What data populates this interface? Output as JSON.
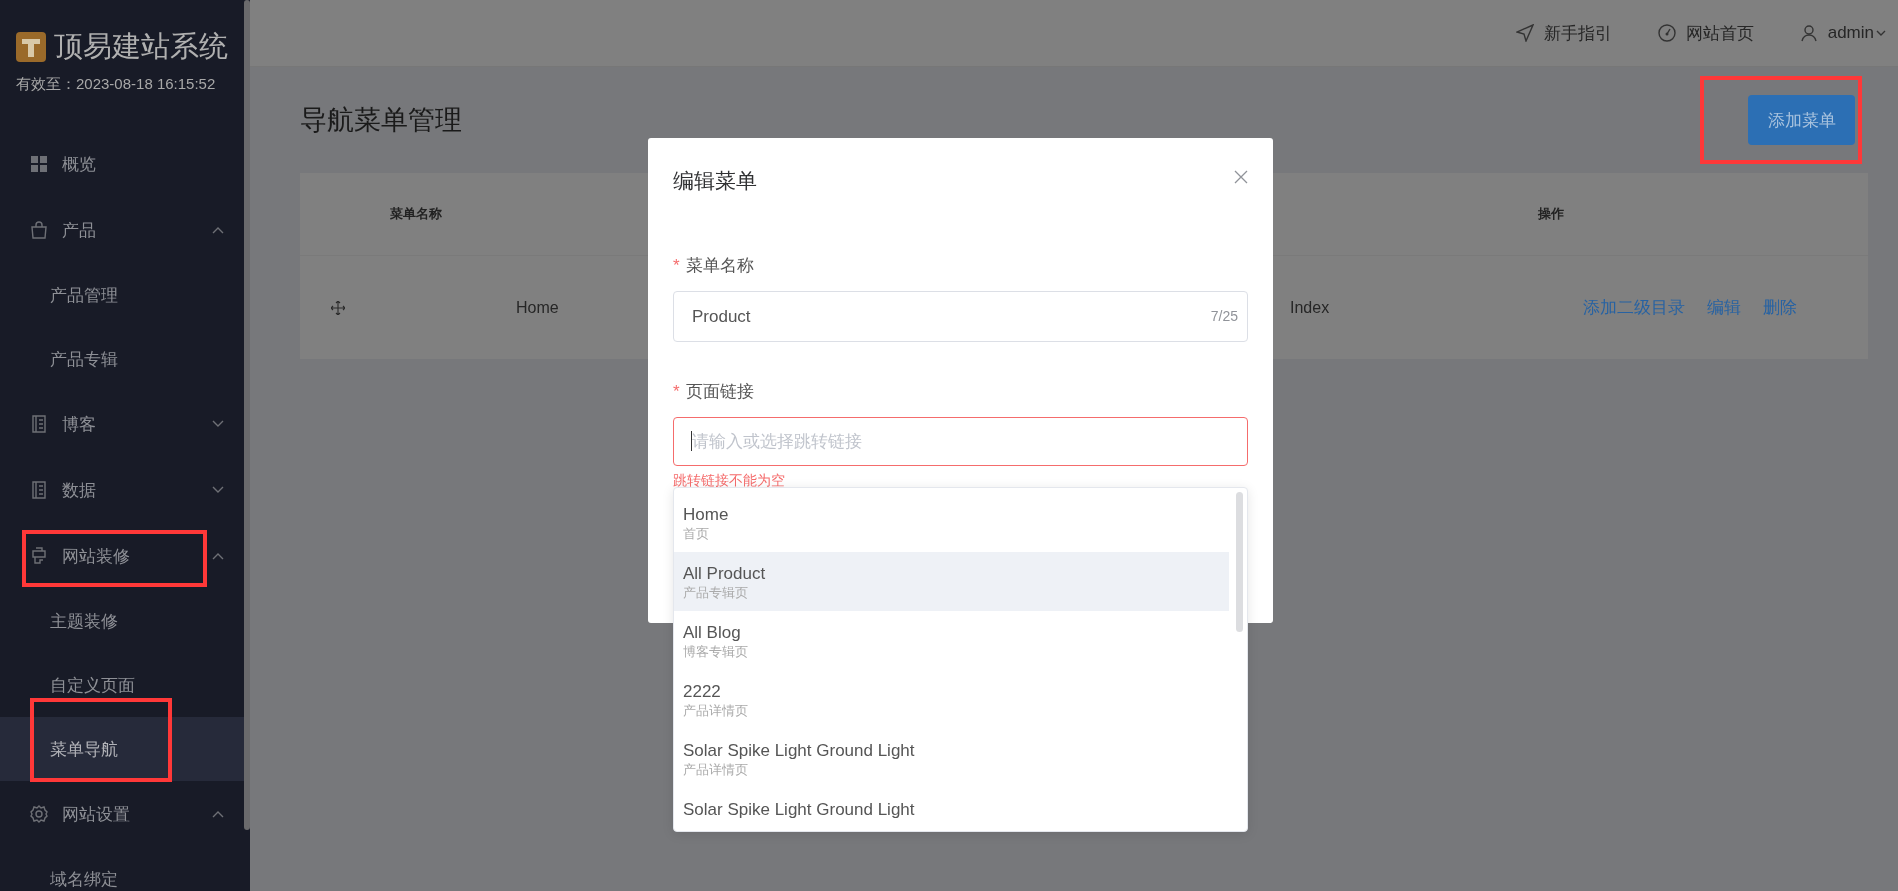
{
  "sidebar": {
    "logo_text": "顶易建站系统",
    "validity": "有效至：2023-08-18 16:15:52",
    "items": [
      {
        "kind": "item",
        "label": "概览",
        "selected": false,
        "highlighted": false
      },
      {
        "kind": "group",
        "label": "产品",
        "expanded": true,
        "highlighted": false,
        "children": [
          {
            "label": "产品管理",
            "selected": false,
            "highlighted": false
          },
          {
            "label": "产品专辑",
            "selected": false,
            "highlighted": false
          }
        ]
      },
      {
        "kind": "group",
        "label": "博客",
        "expanded": false,
        "highlighted": false
      },
      {
        "kind": "group",
        "label": "数据",
        "expanded": false,
        "highlighted": false
      },
      {
        "kind": "group",
        "label": "网站装修",
        "expanded": true,
        "highlighted": true,
        "children": [
          {
            "label": "主题装修",
            "selected": false,
            "highlighted": false
          },
          {
            "label": "自定义页面",
            "selected": false,
            "highlighted": false
          },
          {
            "label": "菜单导航",
            "selected": true,
            "highlighted": true
          }
        ]
      },
      {
        "kind": "group",
        "label": "网站设置",
        "expanded": true,
        "highlighted": false,
        "children": [
          {
            "label": "域名绑定",
            "selected": false,
            "highlighted": false
          }
        ]
      }
    ]
  },
  "topbar": {
    "links": [
      {
        "label": "新手指引"
      },
      {
        "label": "网站首页"
      }
    ],
    "user": "admin"
  },
  "page": {
    "title": "导航菜单管理",
    "add_button": {
      "label": "添加菜单",
      "highlighted": true
    }
  },
  "table": {
    "columns": [
      {
        "label": "菜单名称"
      },
      {
        "label": "操作"
      }
    ],
    "rows": [
      {
        "name": "Home",
        "column_3": "Index",
        "actions": [
          "添加二级目录",
          "编辑",
          "删除"
        ]
      }
    ]
  },
  "modal": {
    "title": "编辑菜单",
    "fields": [
      {
        "label": "菜单名称",
        "required_mark": "*",
        "value": "Product",
        "counter": "7/25",
        "error": false,
        "focused": false
      },
      {
        "label": "页面链接",
        "required_mark": "*",
        "placeholder": "请输入或选择跳转链接",
        "error": true,
        "error_text": "跳转链接不能为空",
        "focused": true
      }
    ],
    "dropdown": {
      "options": [
        {
          "title": "Home",
          "subtitle": "首页",
          "selected": false
        },
        {
          "title": "All Product",
          "subtitle": "产品专辑页",
          "selected": true
        },
        {
          "title": "All Blog",
          "subtitle": "博客专辑页",
          "selected": false
        },
        {
          "title": "2222",
          "subtitle": "产品详情页",
          "selected": false
        },
        {
          "title": "Solar Spike Light Ground Light",
          "subtitle": "产品详情页",
          "selected": false
        },
        {
          "title": "Solar Spike Light Ground Light",
          "selected": false
        }
      ]
    }
  }
}
